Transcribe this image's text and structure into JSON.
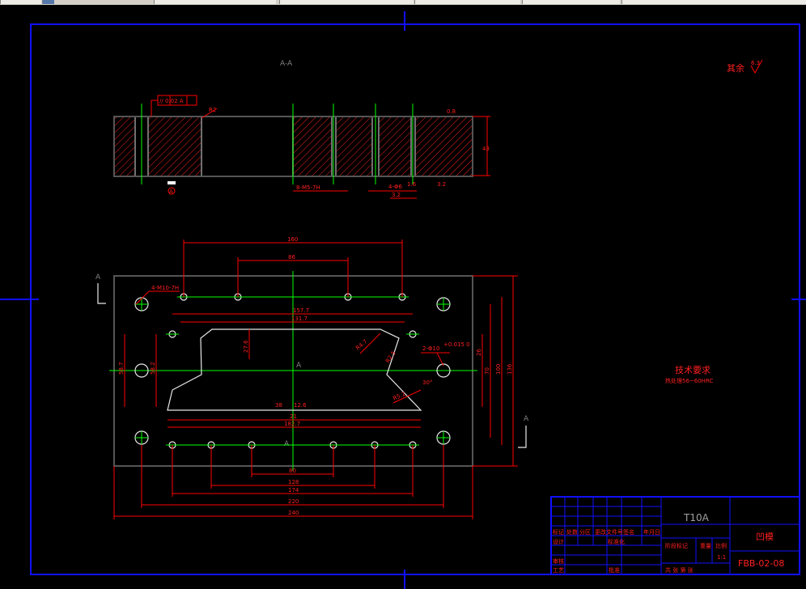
{
  "toolbar": {
    "tabs": [
      "",
      "",
      "",
      "",
      "",
      ""
    ]
  },
  "drawing": {
    "section_label": "A-A",
    "surface_note": "其余",
    "roughness_symbol": "6.3",
    "view_marker_left": "A",
    "view_marker_right": "A",
    "center_marker": "A",
    "center_marker_lower": "A",
    "section": {
      "tolerance_frame": "// 0.02 A",
      "datum_tag": "A",
      "r_note": "R2",
      "thread_note": "8-M5-7H",
      "hole_note": "4-Φ6",
      "height_dim": "43",
      "roughness_tags": [
        "3.2",
        "1.6",
        "3.2",
        "0.8"
      ]
    },
    "plan": {
      "hole_note_left": "4-M10-7H",
      "hole_note_right": "2-Φ10",
      "hole_tol": "+0.015 0",
      "angle_note": "30°",
      "top_dims": [
        "160",
        "86"
      ],
      "opening_dims": [
        "157.7",
        "131.7"
      ],
      "bottom_opening_dims": [
        "21",
        "182.7"
      ],
      "left_vertical_dims": [
        "58.7",
        "58.2"
      ],
      "inner_vertical_dim": "27.6",
      "right_vertical_dims": [
        "26",
        "70",
        "100",
        "136"
      ],
      "radius_notes": [
        "R4.7",
        "R2.5",
        "R5.2"
      ],
      "bottom_dims": [
        "80",
        "128",
        "174",
        "220",
        "240"
      ],
      "small_tags": [
        "38",
        "12.6"
      ]
    },
    "tech_req": {
      "title": "技术要求",
      "line1": "热处理56~60HRC"
    }
  },
  "title_block": {
    "material": "T10A",
    "part_name": "凹模",
    "drawing_no": "FBB-02-08",
    "row_labels": [
      "标记",
      "处数",
      "分区",
      "更改文件号",
      "签名",
      "年月日"
    ],
    "design": "设计",
    "standardize": "标准化",
    "review": "审核",
    "process": "工艺",
    "approve": "批准",
    "stage_mark": "阶段标记",
    "weight": "重量",
    "scale": "比例",
    "scale_value": "1:1",
    "sheet_info": "共 张 第 张"
  }
}
